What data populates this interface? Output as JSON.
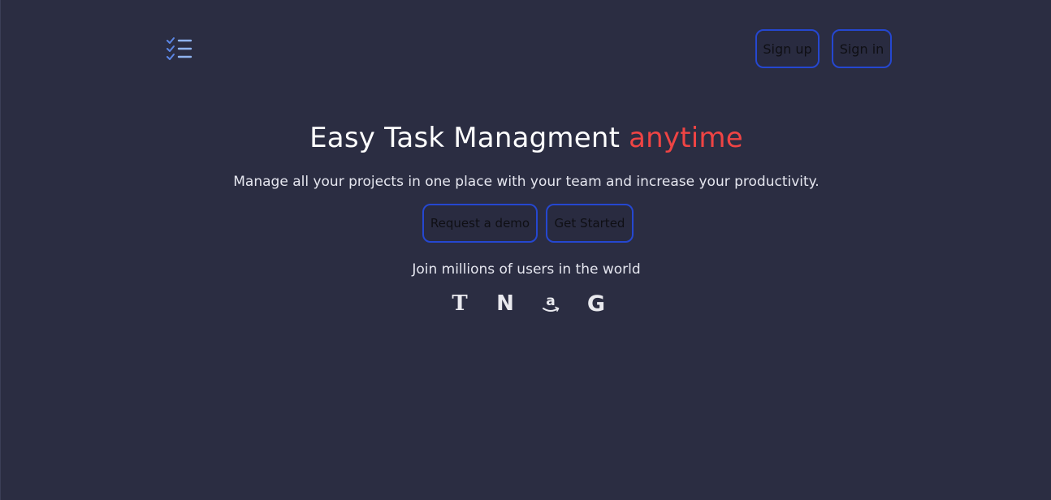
{
  "colors": {
    "background": "#2b2d42",
    "accent": "#ef4444",
    "button_border": "#2547d0",
    "logo_blue": "#5b86e5"
  },
  "nav": {
    "logo_icon": "checklist-icon",
    "signup_label": "Sign up",
    "signin_label": "Sign in"
  },
  "hero": {
    "title_main": "Easy Task Managment",
    "title_accent": "anytime",
    "subtitle": "Manage all your projects in one place with your team and increase your productivity.",
    "demo_label": "Request a demo",
    "start_label": "Get Started"
  },
  "social_proof": {
    "caption": "Join millions of users in the world",
    "brands": [
      {
        "name": "new-york-times-icon",
        "glyph": "T"
      },
      {
        "name": "netflix-icon",
        "glyph": "N"
      },
      {
        "name": "amazon-icon",
        "glyph": "a"
      },
      {
        "name": "google-icon",
        "glyph": "G"
      }
    ]
  }
}
